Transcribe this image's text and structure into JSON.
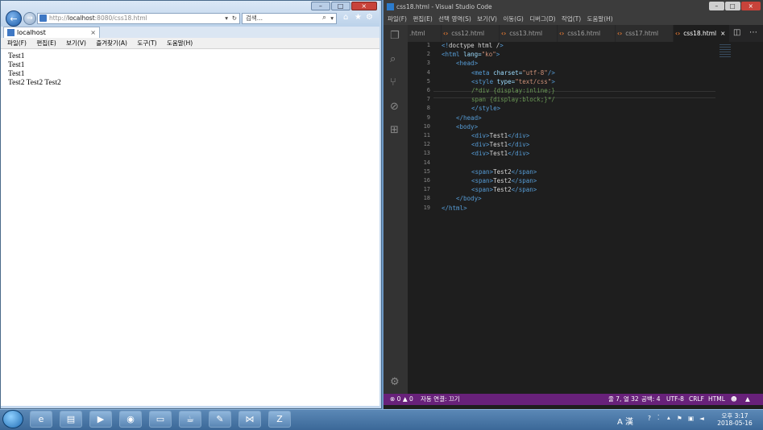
{
  "ie": {
    "address_prefix": "http://",
    "address_host": "localhost",
    "address_rest": ":8080/css18.html",
    "address_dropdown": "▾",
    "refresh_glyph": "↻",
    "search_placeholder": "검색...",
    "tab_title": "localhost",
    "tab_close": "×",
    "menu": [
      "파일(F)",
      "편집(E)",
      "보기(V)",
      "즐겨찾기(A)",
      "도구(T)",
      "도움말(H)"
    ],
    "content_lines": [
      "Test1",
      "Test1",
      "Test1",
      "Test2 Test2 Test2"
    ],
    "window_buttons": [
      "–",
      "□",
      "×"
    ]
  },
  "vscode": {
    "title": "css18.html - Visual Studio Code",
    "window_buttons": [
      "–",
      "□",
      "×"
    ],
    "menu": [
      "파일(F)",
      "편집(E)",
      "선택 영역(S)",
      "보기(V)",
      "이동(G)",
      "디버그(D)",
      "작업(T)",
      "도움말(H)"
    ],
    "tabs": [
      ".html",
      "css12.html",
      "css13.html",
      "css16.html",
      "css17.html",
      "css18.html"
    ],
    "tab_close": "×",
    "line_numbers": [
      "1",
      "2",
      "3",
      "4",
      "5",
      "6",
      "7",
      "8",
      "9",
      "10",
      "11",
      "12",
      "13",
      "14",
      "15",
      "16",
      "17",
      "18",
      "19"
    ],
    "code": {
      "l1_open": "<!",
      "l1_doctype": "doctype html /",
      "l1_close": ">",
      "l2_tag": "<html",
      "l2_attr": " lang=",
      "l2_val": "\"ko\"",
      "l2_end": ">",
      "l3": "<head>",
      "l4_tag": "<meta",
      "l4_attr": " charset=",
      "l4_val": "\"utf-8\"",
      "l4_end": "/>",
      "l5_tag": "<style",
      "l5_attr": " type=",
      "l5_val": "\"text/css\"",
      "l5_end": ">",
      "l6": "/*div {display:inline;}",
      "l7": "span {display:block;}*/",
      "l8": "</style>",
      "l9": "</head>",
      "l10": "<body>",
      "div_open": "<div>",
      "div_close": "</div>",
      "test1": "Test1",
      "span_open": "<span>",
      "span_close": "</span>",
      "test2": "Test2",
      "l18": "</body>",
      "l19": "</html>"
    },
    "status": {
      "errors": "⊗ 0 ▲ 0",
      "autosave": "자동 연결: 끄기",
      "position": "줄 7, 열 32",
      "spaces": "공백: 4",
      "encoding": "UTF-8",
      "eol": "CRLF",
      "language": "HTML",
      "smiley": "☻",
      "bell": "🔔"
    }
  },
  "taskbar": {
    "time_label": "오후 3:17",
    "date_label": "2018-05-16",
    "ime_label": "A 漢"
  }
}
